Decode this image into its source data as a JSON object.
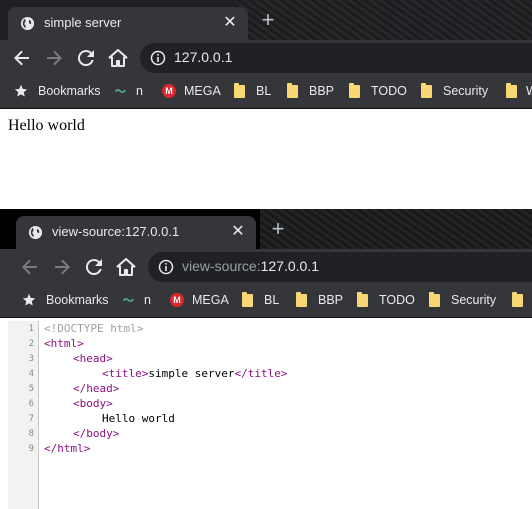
{
  "window1": {
    "tab_title": "simple server",
    "tab_close": "✕",
    "new_tab": "+",
    "url": "127.0.0.1",
    "page_text": "Hello world"
  },
  "window2": {
    "tab_title": "view-source:127.0.0.1",
    "tab_close": "✕",
    "new_tab": "+",
    "url_prefix": "view-source:",
    "url_host": "127.0.0.1"
  },
  "bookmarks": [
    {
      "label": "Bookmarks",
      "icon": "star-icon"
    },
    {
      "label": "n",
      "icon": "link-icon"
    },
    {
      "label": "MEGA",
      "icon": "mega-icon",
      "badge": "M"
    },
    {
      "label": "BL",
      "icon": "folder-icon"
    },
    {
      "label": "BBP",
      "icon": "folder-icon"
    },
    {
      "label": "TODO",
      "icon": "folder-icon"
    },
    {
      "label": "Security",
      "icon": "folder-icon"
    },
    {
      "label": "W",
      "icon": "folder-icon"
    }
  ],
  "source": {
    "line_numbers": [
      "1",
      "2",
      "3",
      "4",
      "5",
      "6",
      "7",
      "8",
      "9"
    ],
    "doctype": "<!DOCTYPE html>",
    "html_open": "<html>",
    "head_open": "<head>",
    "title_open": "<title>",
    "title_text": "simple server",
    "title_close": "</title>",
    "head_close": "</head>",
    "body_open": "<body>",
    "body_text": "Hello world",
    "body_close": "</body>",
    "html_close": "</html>"
  },
  "colors": {
    "tab_active": "#35363a",
    "tab_strip": "#1f2023",
    "omnibox": "#202124",
    "tag_color": "#881280",
    "doctype_color": "#a0a0a0",
    "folder_color": "#f8d775",
    "mega_color": "#d9272e"
  }
}
